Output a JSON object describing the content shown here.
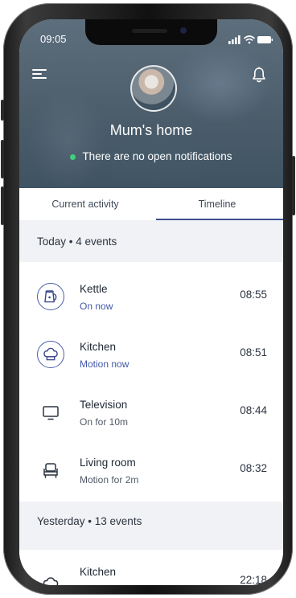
{
  "status_bar": {
    "time": "09:05"
  },
  "header": {
    "home_name": "Mum's home",
    "notification_text": "There are no open notifications",
    "status_color": "#3fcf7d"
  },
  "tabs": [
    {
      "label": "Current activity",
      "active": false
    },
    {
      "label": "Timeline",
      "active": true
    }
  ],
  "today": {
    "title": "Today • 4 events",
    "events": [
      {
        "name": "Kettle",
        "status": "On now",
        "time": "08:55",
        "icon": "kettle-icon"
      },
      {
        "name": "Kitchen",
        "status": "Motion now",
        "time": "08:51",
        "icon": "chef-hat-icon"
      },
      {
        "name": "Television",
        "status": "On for 10m",
        "time": "08:44",
        "icon": "tv-icon"
      },
      {
        "name": "Living room",
        "status": "Motion for 2m",
        "time": "08:32",
        "icon": "armchair-icon"
      }
    ]
  },
  "yesterday": {
    "title": "Yesterday • 13 events",
    "events": [
      {
        "name": "Kitchen",
        "time": "22:18",
        "icon": "chef-hat-icon"
      }
    ]
  },
  "colors": {
    "accent": "#3d4f8f",
    "link": "#4258a8"
  }
}
